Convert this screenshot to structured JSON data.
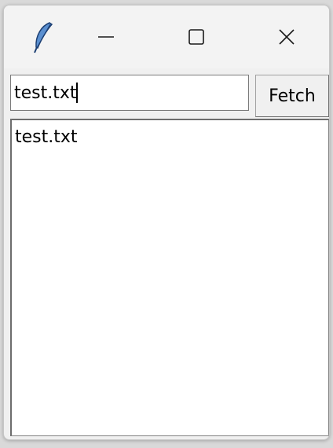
{
  "titlebar": {
    "icon": "feather-icon",
    "buttons": {
      "minimize": "minimize-icon",
      "maximize": "maximize-icon",
      "close": "close-icon"
    }
  },
  "entry": {
    "value": "test.txt"
  },
  "fetch_button": {
    "label": "Fetch"
  },
  "listbox": {
    "items": [
      "test.txt"
    ]
  }
}
